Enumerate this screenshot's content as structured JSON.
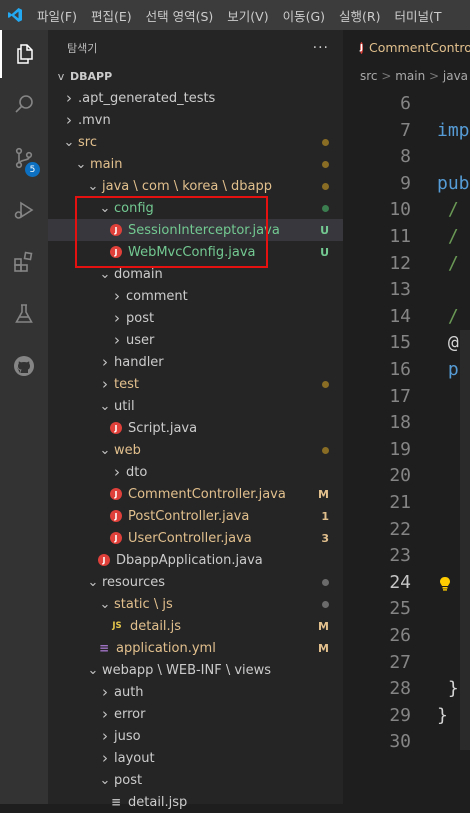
{
  "menubar": {
    "items": [
      "파일(F)",
      "편집(E)",
      "선택 영역(S)",
      "보기(V)",
      "이동(G)",
      "실행(R)",
      "터미널(T"
    ]
  },
  "activity": {
    "scm_badge": "5"
  },
  "explorer": {
    "title": "탐색기",
    "more": "···",
    "root": "DBAPP",
    "rows": [
      {
        "label": ".apt_generated_tests",
        "chev": ">",
        "color": "#cccccc"
      },
      {
        "label": ".mvn",
        "chev": ">",
        "color": "#cccccc"
      },
      {
        "label": "src",
        "chev": "v",
        "color": "#e2c08d",
        "dot": "#8a6d24"
      },
      {
        "label": "main",
        "chev": "v",
        "color": "#e2c08d",
        "dot": "#8a6d24"
      },
      {
        "label": "java \\ com \\ korea \\ dbapp",
        "chev": "v",
        "color": "#e2c08d",
        "dot": "#8a6d24"
      },
      {
        "label": "config",
        "chev": "v",
        "color": "#73c991",
        "dot": "#3b7d4f"
      },
      {
        "label": "SessionInterceptor.java",
        "icon": "java",
        "color": "#73c991",
        "status": "U",
        "status_color": "#73c991",
        "selected": true
      },
      {
        "label": "WebMvcConfig.java",
        "icon": "java",
        "color": "#73c991",
        "status": "U",
        "status_color": "#73c991"
      },
      {
        "label": "domain",
        "chev": "v",
        "color": "#cccccc"
      },
      {
        "label": "comment",
        "chev": ">",
        "color": "#cccccc"
      },
      {
        "label": "post",
        "chev": ">",
        "color": "#cccccc"
      },
      {
        "label": "user",
        "chev": ">",
        "color": "#cccccc"
      },
      {
        "label": "handler",
        "chev": ">",
        "color": "#cccccc"
      },
      {
        "label": "test",
        "chev": ">",
        "color": "#e2c08d",
        "dot": "#8a6d24"
      },
      {
        "label": "util",
        "chev": "v",
        "color": "#cccccc"
      },
      {
        "label": "Script.java",
        "icon": "java",
        "color": "#cccccc"
      },
      {
        "label": "web",
        "chev": "v",
        "color": "#e2c08d",
        "dot": "#8a6d24"
      },
      {
        "label": "dto",
        "chev": ">",
        "color": "#cccccc"
      },
      {
        "label": "CommentController.java",
        "icon": "java",
        "color": "#e2c08d",
        "status": "M",
        "status_color": "#e2c08d"
      },
      {
        "label": "PostController.java",
        "icon": "java",
        "color": "#e2c08d",
        "status": "1",
        "status_color": "#e2c08d"
      },
      {
        "label": "UserController.java",
        "icon": "java",
        "color": "#e2c08d",
        "status": "3",
        "status_color": "#e2c08d"
      },
      {
        "label": "DbappApplication.java",
        "icon": "java",
        "color": "#cccccc"
      },
      {
        "label": "resources",
        "chev": "v",
        "color": "#cccccc",
        "dot": "#6b6b6b"
      },
      {
        "label": "static \\ js",
        "chev": "v",
        "color": "#e2c08d",
        "dot": "#6b6b6b"
      },
      {
        "label": "detail.js",
        "icon": "js",
        "color": "#e2c08d",
        "status": "M",
        "status_color": "#e2c08d"
      },
      {
        "label": "application.yml",
        "icon": "yml",
        "color": "#e2c08d",
        "status": "M",
        "status_color": "#e2c08d"
      },
      {
        "label": "webapp \\ WEB-INF \\ views",
        "chev": "v",
        "color": "#cccccc"
      },
      {
        "label": "auth",
        "chev": ">",
        "color": "#cccccc"
      },
      {
        "label": "error",
        "chev": ">",
        "color": "#cccccc"
      },
      {
        "label": "juso",
        "chev": ">",
        "color": "#cccccc"
      },
      {
        "label": "layout",
        "chev": ">",
        "color": "#cccccc"
      },
      {
        "label": "post",
        "chev": "v",
        "color": "#cccccc"
      },
      {
        "label": "detail.jsp",
        "icon": "jsp",
        "color": "#cccccc"
      }
    ]
  },
  "editor": {
    "tab_label": "CommentControlle",
    "breadcrumb": [
      "src",
      "main",
      "java"
    ],
    "line_numbers": [
      "6",
      "7",
      "8",
      "9",
      "10",
      "11",
      "12",
      "13",
      "14",
      "15",
      "16",
      "17",
      "18",
      "19",
      "20",
      "21",
      "22",
      "23",
      "24",
      "25",
      "26",
      "27",
      "28",
      "29",
      "30"
    ],
    "current_line": "24",
    "code": [
      {
        "line": "7",
        "text": "imp",
        "color": "#569cd6"
      },
      {
        "line": "9",
        "text": "pub",
        "color": "#569cd6"
      },
      {
        "line": "10",
        "text": " /",
        "color": "#6a9955"
      },
      {
        "line": "11",
        "text": " /",
        "color": "#6a9955"
      },
      {
        "line": "12",
        "text": " /",
        "color": "#6a9955"
      },
      {
        "line": "14",
        "text": " /",
        "color": "#6a9955"
      },
      {
        "line": "15",
        "text": " @",
        "color": "#d4d4d4"
      },
      {
        "line": "16",
        "text": " p",
        "color": "#569cd6"
      },
      {
        "line": "28",
        "text": " }",
        "color": "#d4d4d4"
      },
      {
        "line": "29",
        "text": "}",
        "color": "#d4d4d4"
      }
    ],
    "lightbulb_line": "24"
  }
}
